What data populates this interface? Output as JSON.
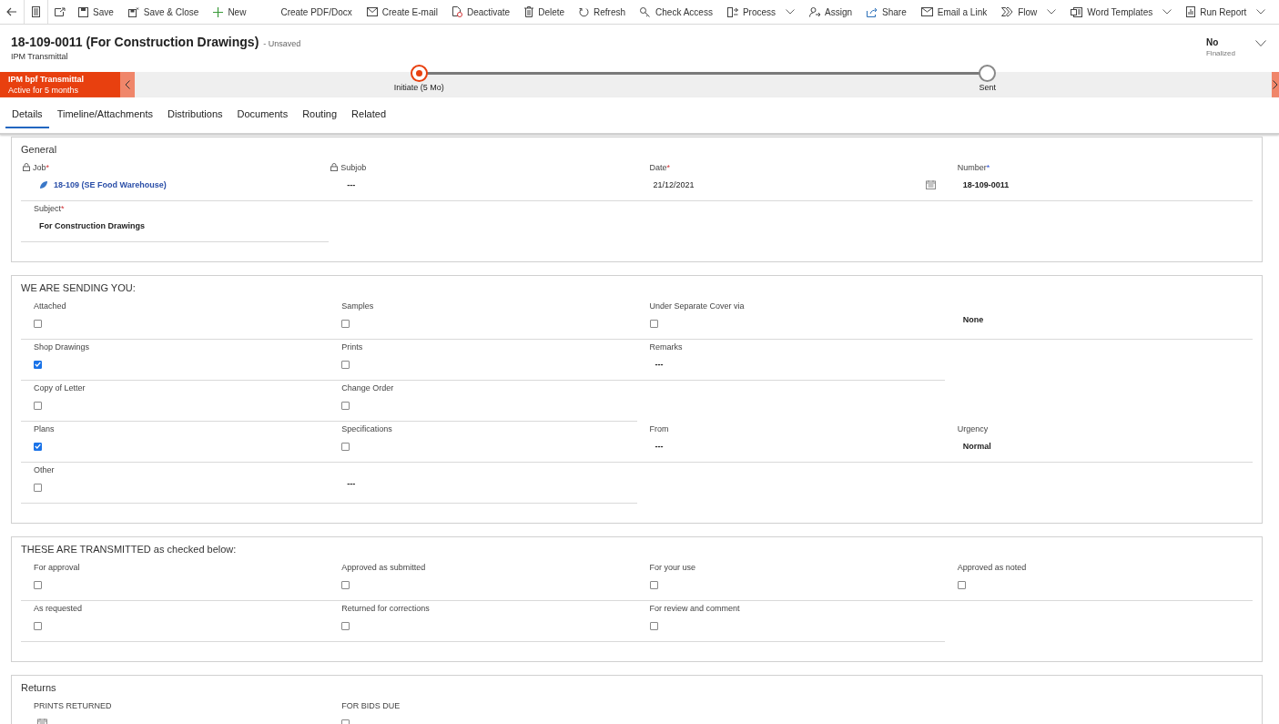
{
  "command_bar": {
    "items": [
      {
        "label": "Save",
        "menu": false
      },
      {
        "label": "Save & Close",
        "menu": false
      },
      {
        "label": "New",
        "menu": false
      },
      {
        "label": "Create PDF/Docx",
        "menu": false
      },
      {
        "label": "Create E-mail",
        "menu": false
      },
      {
        "label": "Deactivate",
        "menu": false
      },
      {
        "label": "Delete",
        "menu": false
      },
      {
        "label": "Refresh",
        "menu": false
      },
      {
        "label": "Check Access",
        "menu": false
      },
      {
        "label": "Process",
        "menu": true
      },
      {
        "label": "Assign",
        "menu": false
      },
      {
        "label": "Share",
        "menu": false
      },
      {
        "label": "Email a Link",
        "menu": false
      },
      {
        "label": "Flow",
        "menu": true
      },
      {
        "label": "Word Templates",
        "menu": true
      },
      {
        "label": "Run Report",
        "menu": true
      }
    ]
  },
  "header": {
    "title": "18-109-0011 (For Construction Drawings)",
    "save_state": "- Unsaved",
    "entity": "IPM Transmittal",
    "header_field": {
      "value": "No",
      "label": "Finalized"
    }
  },
  "process": {
    "name": "IPM bpf Transmittal",
    "status": "Active for 5 months",
    "stages": [
      {
        "label": "Initiate  (5 Mo)",
        "selected": true
      },
      {
        "label": "Sent",
        "selected": false
      }
    ]
  },
  "tabs": [
    {
      "label": "Details",
      "selected": true
    },
    {
      "label": "Timeline/Attachments",
      "selected": false
    },
    {
      "label": "Distributions",
      "selected": false
    },
    {
      "label": "Documents",
      "selected": false
    },
    {
      "label": "Routing",
      "selected": false
    },
    {
      "label": "Related",
      "selected": false
    }
  ],
  "sections": [
    {
      "title": "General",
      "rows": [
        [
          {
            "kind": "lookup",
            "label": "Job",
            "required_mark": "*",
            "recommended": false,
            "locked": true,
            "value": "18-109 (SE Food Warehouse)"
          },
          {
            "kind": "text",
            "label": "Subjob",
            "locked": true,
            "value": "---"
          },
          {
            "kind": "date",
            "label": "Date",
            "required_mark": "*",
            "recommended": false,
            "value": "21/12/2021"
          },
          {
            "kind": "text",
            "label": "Number",
            "required_mark": "*",
            "recommended": true,
            "value": "18-109-0011"
          }
        ],
        [
          {
            "kind": "text",
            "label": "Subject",
            "required_mark": "*",
            "recommended": false,
            "value": "For Construction Drawings"
          }
        ]
      ]
    },
    {
      "title": "WE ARE SENDING YOU:",
      "rows": [
        [
          {
            "kind": "checkbox",
            "label": "Attached",
            "checked": false
          },
          {
            "kind": "checkbox",
            "label": "Samples",
            "checked": false
          },
          {
            "kind": "checkbox",
            "label": "Under Separate Cover via",
            "checked": false
          },
          {
            "kind": "text",
            "value": "None"
          }
        ],
        [
          {
            "kind": "checkbox",
            "label": "Shop Drawings",
            "checked": true
          },
          {
            "kind": "checkbox",
            "label": "Prints",
            "checked": false
          },
          {
            "kind": "text",
            "label": "Remarks",
            "value": "---"
          }
        ],
        [
          {
            "kind": "checkbox",
            "label": "Copy of Letter",
            "checked": false
          },
          {
            "kind": "checkbox",
            "label": "Change Order",
            "checked": false
          }
        ],
        [
          {
            "kind": "checkbox",
            "label": "Plans",
            "checked": true
          },
          {
            "kind": "checkbox",
            "label": "Specifications",
            "checked": false
          },
          {
            "kind": "text",
            "label": "From",
            "value": "---"
          },
          {
            "kind": "text",
            "label": "Urgency",
            "value": "Normal"
          }
        ],
        [
          {
            "kind": "checkbox",
            "label": "Other",
            "checked": false
          },
          {
            "kind": "text",
            "value": "---"
          }
        ]
      ]
    },
    {
      "title": "THESE ARE TRANSMITTED as checked below:",
      "rows": [
        [
          {
            "kind": "checkbox",
            "label": "For approval",
            "checked": false
          },
          {
            "kind": "checkbox",
            "label": "Approved as submitted",
            "checked": false
          },
          {
            "kind": "checkbox",
            "label": "For your use",
            "checked": false
          },
          {
            "kind": "checkbox",
            "label": "Approved as noted",
            "checked": false
          }
        ],
        [
          {
            "kind": "checkbox",
            "label": "As requested",
            "checked": false
          },
          {
            "kind": "checkbox",
            "label": "Returned for corrections",
            "checked": false
          },
          {
            "kind": "checkbox",
            "label": "For review and comment",
            "checked": false
          }
        ]
      ]
    },
    {
      "title": "Returns",
      "rows": [
        [
          {
            "kind": "date",
            "label": "PRINTS RETURNED"
          },
          {
            "kind": "checkbox",
            "label": "FOR BIDS DUE",
            "checked": false
          }
        ]
      ]
    }
  ]
}
